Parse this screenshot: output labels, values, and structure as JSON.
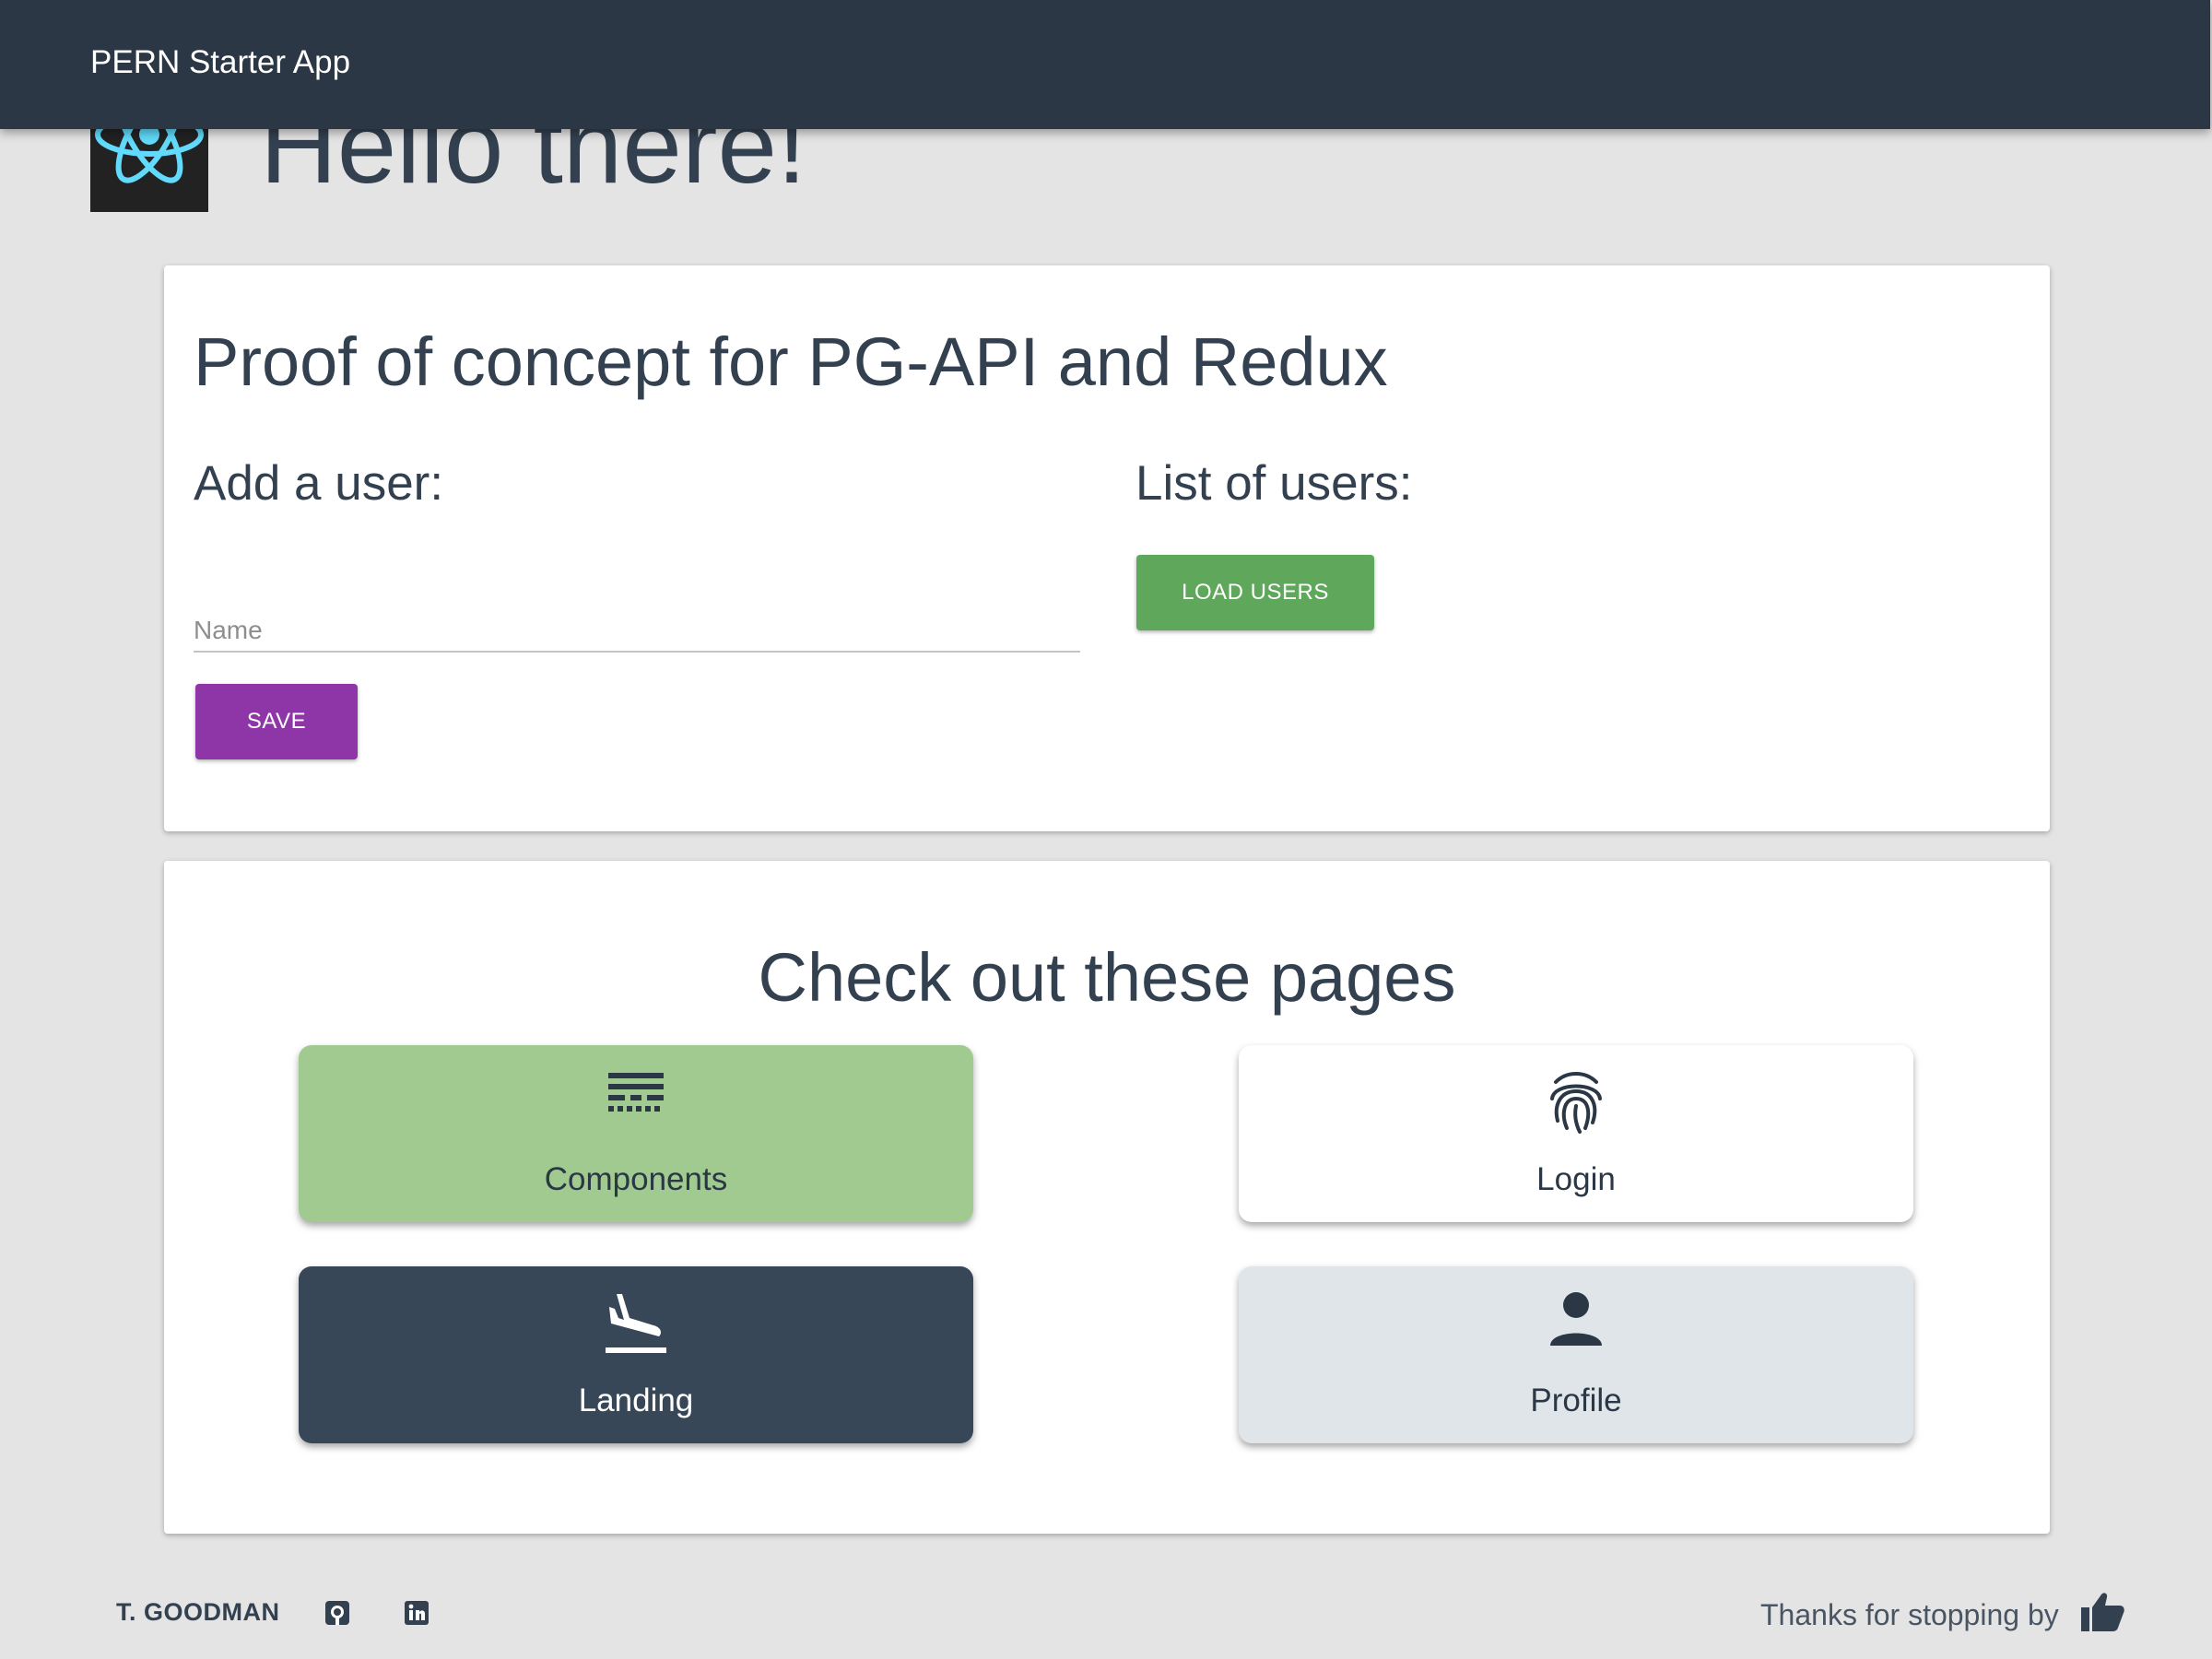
{
  "appbar": {
    "title": "PERN Starter App"
  },
  "hero": {
    "title": "Hello there!",
    "logo_icon": "react-logo-icon"
  },
  "poc": {
    "title": "Proof of concept for PG-API and Redux",
    "add_user": {
      "heading": "Add a user:",
      "name_placeholder": "Name",
      "name_value": "",
      "save_label": "SAVE"
    },
    "list_users": {
      "heading": "List of users:",
      "load_label": "LOAD USERS"
    }
  },
  "pages": {
    "title": "Check out these pages",
    "tiles": [
      {
        "label": "Components",
        "icon": "components-icon"
      },
      {
        "label": "Login",
        "icon": "fingerprint-icon"
      },
      {
        "label": "Landing",
        "icon": "flight-land-icon"
      },
      {
        "label": "Profile",
        "icon": "person-icon"
      }
    ]
  },
  "footer": {
    "author": "T. GOODMAN",
    "github_icon": "github-icon",
    "linkedin_icon": "linkedin-icon",
    "thanks": "Thanks for stopping by",
    "thumb_icon": "thumbs-up-icon"
  },
  "colors": {
    "appbar": "#2b3745",
    "save_button": "#8e35a8",
    "load_button": "#5fa85b",
    "components_tile": "#a0ca8f",
    "login_tile": "#ffffff",
    "landing_tile": "#374757",
    "profile_tile": "#dfe5e9",
    "react_logo": "#61dafb"
  }
}
